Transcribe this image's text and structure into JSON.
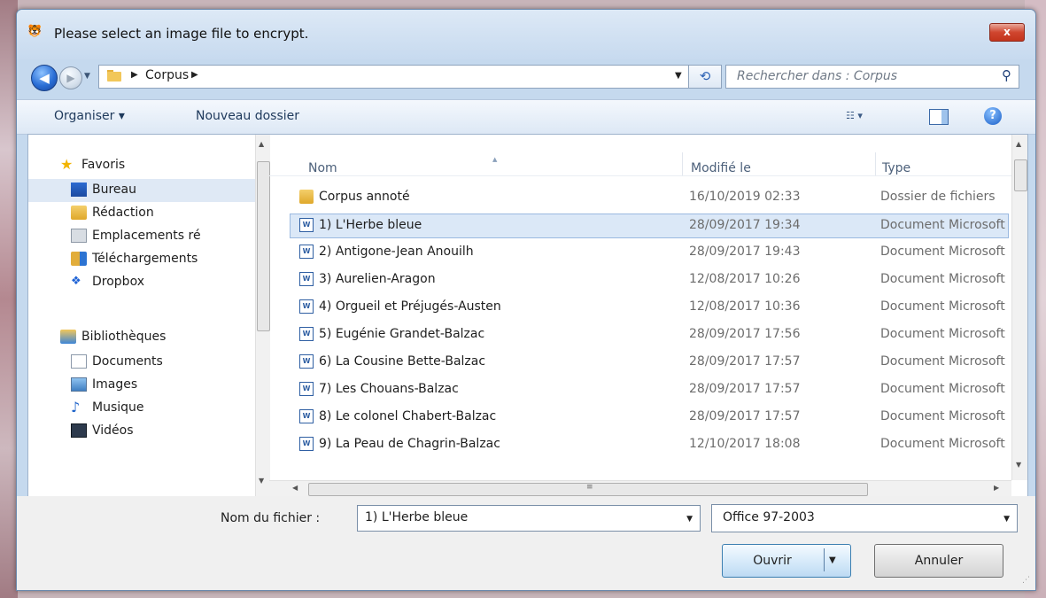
{
  "window": {
    "title": "Please select an image file to encrypt.",
    "app_icon": "tiger-app-icon",
    "close_label": "x"
  },
  "navigation": {
    "back_icon": "back-arrow-icon",
    "forward_icon": "forward-arrow-icon"
  },
  "address": {
    "crumbs": [
      "Corpus"
    ],
    "separator": "▶"
  },
  "search": {
    "placeholder": "Rechercher dans : Corpus"
  },
  "toolbar": {
    "organise": "Organiser ▾",
    "new_folder": "Nouveau dossier"
  },
  "sidebar": {
    "favorites_label": "Favoris",
    "items": [
      {
        "label": "Bureau",
        "icon": "desktop-icon",
        "selected": true
      },
      {
        "label": "Rédaction",
        "icon": "folder-icon"
      },
      {
        "label": "Emplacements ré",
        "icon": "recent-places-icon"
      },
      {
        "label": "Téléchargements",
        "icon": "downloads-icon"
      },
      {
        "label": "Dropbox",
        "icon": "dropbox-icon"
      }
    ],
    "libraries_label": "Bibliothèques",
    "libraries": [
      {
        "label": "Documents",
        "icon": "documents-icon"
      },
      {
        "label": "Images",
        "icon": "images-icon"
      },
      {
        "label": "Musique",
        "icon": "music-icon"
      },
      {
        "label": "Vidéos",
        "icon": "videos-icon"
      }
    ]
  },
  "file_list": {
    "columns": {
      "name": "Nom",
      "modified": "Modifié le",
      "type": "Type"
    },
    "rows": [
      {
        "name": "Corpus annoté",
        "date": "16/10/2019 02:33",
        "type": "Dossier de fichiers",
        "icon": "folder-icon"
      },
      {
        "name": "1) L'Herbe bleue",
        "date": "28/09/2017 19:34",
        "type": "Document Microsoft",
        "icon": "word-doc-icon",
        "selected": true
      },
      {
        "name": "2) Antigone-Jean Anouilh",
        "date": "28/09/2017 19:43",
        "type": "Document Microsoft",
        "icon": "word-doc-icon"
      },
      {
        "name": "3) Aurelien-Aragon",
        "date": "12/08/2017 10:26",
        "type": "Document Microsoft",
        "icon": "word-doc-icon"
      },
      {
        "name": "4) Orgueil et Préjugés-Austen",
        "date": "12/08/2017 10:36",
        "type": "Document Microsoft",
        "icon": "word-doc-icon"
      },
      {
        "name": "5) Eugénie Grandet-Balzac",
        "date": "28/09/2017 17:56",
        "type": "Document Microsoft",
        "icon": "word-doc-icon"
      },
      {
        "name": "6) La Cousine Bette-Balzac",
        "date": "28/09/2017 17:57",
        "type": "Document Microsoft",
        "icon": "word-doc-icon"
      },
      {
        "name": "7) Les Chouans-Balzac",
        "date": "28/09/2017 17:57",
        "type": "Document Microsoft",
        "icon": "word-doc-icon"
      },
      {
        "name": "8) Le colonel Chabert-Balzac",
        "date": "28/09/2017 17:57",
        "type": "Document Microsoft",
        "icon": "word-doc-icon"
      },
      {
        "name": "9) La Peau de Chagrin-Balzac",
        "date": "12/10/2017 18:08",
        "type": "Document Microsoft",
        "icon": "word-doc-icon"
      }
    ]
  },
  "footer": {
    "filename_label": "Nom du fichier :",
    "filename_value": "1) L'Herbe bleue",
    "filter_value": "Office 97-2003",
    "open_label": "Ouvrir",
    "cancel_label": "Annuler"
  },
  "colors": {
    "window_frame": "#c5d9ee",
    "selection": "#dbe8f7",
    "close_red": "#c3341c"
  }
}
